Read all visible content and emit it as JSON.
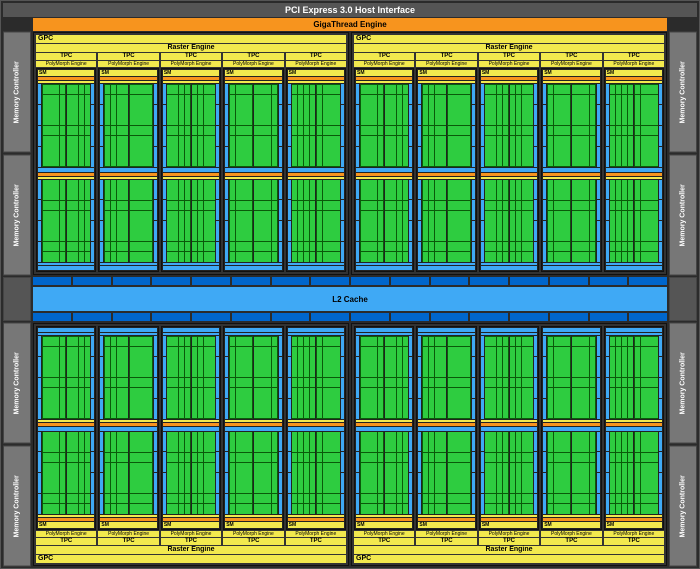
{
  "pci_label": "PCI Express 3.0 Host Interface",
  "giga_label": "GigaThread Engine",
  "mc_label": "Memory Controller",
  "gpc_label": "GPC",
  "raster_label": "Raster Engine",
  "tpc_label": "TPC",
  "poly_label": "PolyMorph Engine",
  "sm_label": "SM",
  "l2_label": "L2 Cache",
  "arrow_glyph": "⇅",
  "architecture": {
    "gpc_count": 4,
    "tpc_per_gpc": 5,
    "sm_per_tpc": 1,
    "memory_controllers": 8,
    "layout": "Pascal-style GPU block diagram"
  }
}
